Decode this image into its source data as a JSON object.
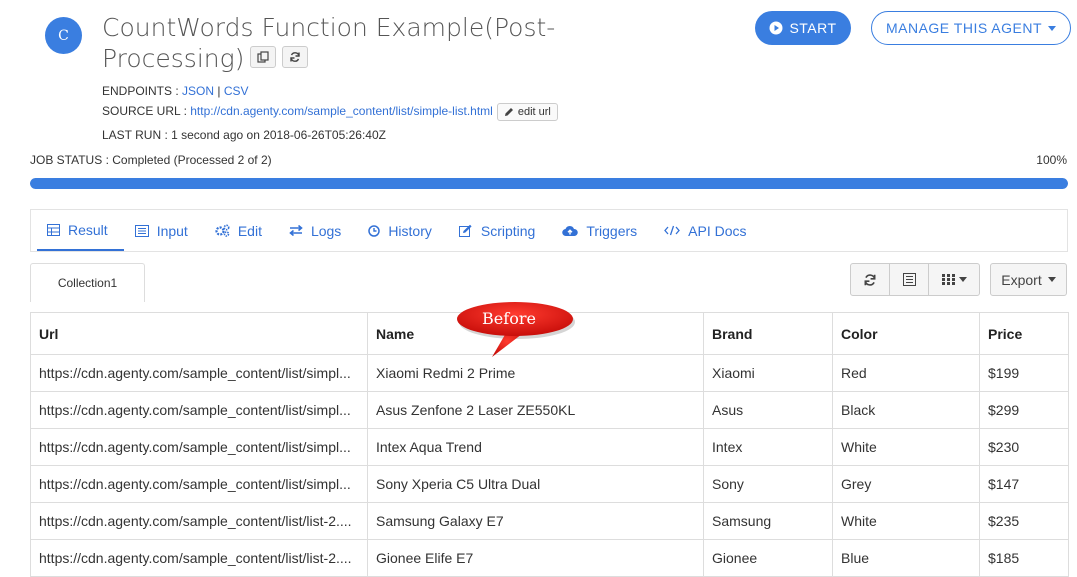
{
  "header": {
    "avatar_letter": "C",
    "title": "CountWords Function Example(Post-Processing)",
    "start_label": "START",
    "manage_label": "MANAGE THIS AGENT"
  },
  "meta": {
    "endpoints_label": "ENDPOINTS : ",
    "endpoints": [
      "JSON",
      "CSV"
    ],
    "source_label": "SOURCE URL : ",
    "source_url": "http://cdn.agenty.com/sample_content/list/simple-list.html",
    "edit_url_label": "edit url",
    "last_run": "LAST RUN : 1 second ago on 2018-06-26T05:26:40Z"
  },
  "job": {
    "status_text": "JOB STATUS : Completed (Processed 2 of 2)",
    "percent_label": "100%",
    "progress": 1.0
  },
  "tabs": [
    {
      "label": "Result",
      "icon": "table-icon"
    },
    {
      "label": "Input",
      "icon": "list-icon"
    },
    {
      "label": "Edit",
      "icon": "cogs-icon"
    },
    {
      "label": "Logs",
      "icon": "exchange-icon"
    },
    {
      "label": "History",
      "icon": "clock-icon"
    },
    {
      "label": "Scripting",
      "icon": "edit-icon"
    },
    {
      "label": "Triggers",
      "icon": "cloud-upload-icon"
    },
    {
      "label": "API Docs",
      "icon": "code-icon"
    }
  ],
  "collection_tab": "Collection1",
  "export_label": "Export",
  "callout_text": "Before",
  "table": {
    "columns": [
      "Url",
      "Name",
      "Brand",
      "Color",
      "Price"
    ],
    "rows": [
      [
        "https://cdn.agenty.com/sample_content/list/simpl...",
        "Xiaomi Redmi 2 Prime",
        "Xiaomi",
        "Red",
        "$199"
      ],
      [
        "https://cdn.agenty.com/sample_content/list/simpl...",
        "Asus Zenfone 2 Laser ZE550KL",
        "Asus",
        "Black",
        "$299"
      ],
      [
        "https://cdn.agenty.com/sample_content/list/simpl...",
        "Intex Aqua Trend",
        "Intex",
        "White",
        "$230"
      ],
      [
        "https://cdn.agenty.com/sample_content/list/simpl...",
        "Sony Xperia C5 Ultra Dual",
        "Sony",
        "Grey",
        "$147"
      ],
      [
        "https://cdn.agenty.com/sample_content/list/list-2....",
        "Samsung Galaxy E7",
        "Samsung",
        "White",
        "$235"
      ],
      [
        "https://cdn.agenty.com/sample_content/list/list-2....",
        "Gionee Elife E7",
        "Gionee",
        "Blue",
        "$185"
      ]
    ]
  },
  "colors": {
    "accent": "#3a7ee0",
    "link": "#3371d6",
    "callout": "#e0140f"
  }
}
